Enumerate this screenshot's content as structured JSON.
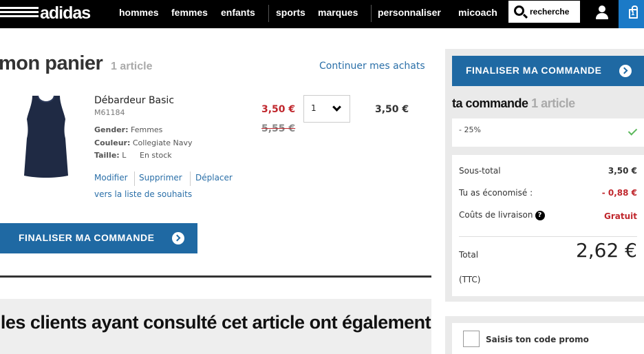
{
  "nav": {
    "logo": "adidas",
    "links": [
      "hommes",
      "femmes",
      "enfants",
      "sports",
      "marques",
      "personnaliser",
      "micoach"
    ],
    "search_label": "recherche"
  },
  "cart": {
    "title": "mon panier",
    "count": "1 article",
    "continue_link": "Continuer mes achats",
    "item": {
      "name": "Débardeur Basic",
      "sku": "M61184",
      "gender_label": "Gender:",
      "gender": "Femmes",
      "color_label": "Couleur:",
      "color": "Collegiate Navy",
      "size_label": "Taille:",
      "size": "L",
      "stock": "En stock",
      "price_sale": "3,50 €",
      "price_old": "5,55 €",
      "quantity": "1",
      "line_total": "3,50 €",
      "actions": [
        "Modifier",
        "Supprimer",
        "Déplacer"
      ],
      "actions_line2": "vers la liste de souhaits"
    },
    "checkout_label": "FINALISER MA COMMANDE"
  },
  "recommendations": {
    "title": "les clients ayant consulté cet article ont également"
  },
  "order": {
    "checkout_label": "FINALISER MA COMMANDE",
    "title": "ta commande",
    "count": "1 article",
    "promo": "- 25%",
    "subtotal_label": "Sous-total",
    "subtotal": "3,50 €",
    "saved_label": "Tu as économisé :",
    "saved": "- 0,88 €",
    "shipping_label": "Coûts de livraison",
    "shipping": "Gratuit",
    "total_label": "Total",
    "total_ttc": "(TTC)",
    "total": "2,62 €",
    "code_label": "Saisis ton code promo"
  },
  "colors": {
    "accent_blue": "#1f69a3",
    "cart_blue": "#1b7ac7",
    "sale_red": "#c0272d",
    "link_blue": "#2a6fa8"
  }
}
